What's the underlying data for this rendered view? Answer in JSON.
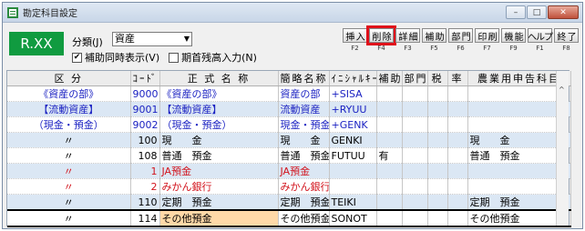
{
  "window": {
    "title": "勘定科目設定",
    "buttons": [
      "–",
      "□",
      "✕"
    ]
  },
  "badge": "R.XX",
  "kind": {
    "label": "分類(J)",
    "value": "資産"
  },
  "options": [
    {
      "label": "補助同時表示(V)",
      "checked": true
    },
    {
      "label": "期首残高入力(N)",
      "checked": false
    }
  ],
  "fkeys": [
    {
      "label": "挿 入",
      "key": "F2"
    },
    {
      "label": "削 除",
      "key": "F4"
    },
    {
      "label": "詳 細",
      "key": "F3"
    },
    {
      "label": "補 助",
      "key": "F5"
    },
    {
      "label": "部 門",
      "key": "F6"
    },
    {
      "label": "印 刷",
      "key": "F7"
    },
    {
      "label": "機 能",
      "key": "F9"
    },
    {
      "label": "ヘルプ",
      "key": "F1"
    },
    {
      "label": "終 了",
      "key": "F8"
    }
  ],
  "headers": [
    "区 分",
    "ｺｰﾄﾞ",
    "正 式 名 称",
    "簡略名称",
    "ｲﾆｼｬﾙｷｰ",
    "補助",
    "部門",
    "税",
    "率",
    "農業用申告科目"
  ],
  "rows": [
    {
      "cat": "《資産の部》",
      "code": "9000",
      "name": "《資産の部》",
      "short": "資産の部",
      "initial": "+SISA",
      "aux": "",
      "tax": "",
      "farm": "",
      "style": "blue"
    },
    {
      "cat": "【流動資産】",
      "code": "9001",
      "name": "【流動資産】",
      "short": "流動資産",
      "initial": "+RYUU",
      "aux": "",
      "tax": "",
      "farm": "",
      "style": "blue hl-row"
    },
    {
      "cat": "（現金・預金）",
      "code": "9002",
      "name": "（現金・預金）",
      "short": "現金・預金",
      "initial": "+GENK",
      "aux": "",
      "tax": "",
      "farm": "",
      "style": "blue"
    },
    {
      "cat": "〃",
      "code": "100",
      "name": "現　　金",
      "short": "現　　金",
      "initial": "GENKI",
      "aux": "",
      "tax": "",
      "farm": "現　　金",
      "style": "hl-row"
    },
    {
      "cat": "〃",
      "code": "108",
      "name": "普通　預金",
      "short": "普通　預金",
      "initial": "FUTUU",
      "aux": "有",
      "tax": "",
      "farm": "普通　預金",
      "style": ""
    },
    {
      "cat": "〃",
      "code": "1",
      "name": "JA預金",
      "short": "JA預金",
      "initial": "",
      "aux": "",
      "tax": "",
      "farm": "",
      "style": "red hl-row"
    },
    {
      "cat": "〃",
      "code": "2",
      "name": "みかん銀行",
      "short": "みかん銀行",
      "initial": "",
      "aux": "",
      "tax": "",
      "farm": "",
      "style": "red"
    },
    {
      "cat": "〃",
      "code": "110",
      "name": "定期　預金",
      "short": "定期　預金",
      "initial": "TEIKI",
      "aux": "",
      "tax": "",
      "farm": "定期　預金",
      "style": "hl-row"
    },
    {
      "cat": "〃",
      "code": "114",
      "name": "その他預金",
      "short": "その他預金",
      "initial": "SONOT",
      "aux": "",
      "tax": "",
      "farm": "その他預金",
      "style": "sel-row"
    }
  ]
}
